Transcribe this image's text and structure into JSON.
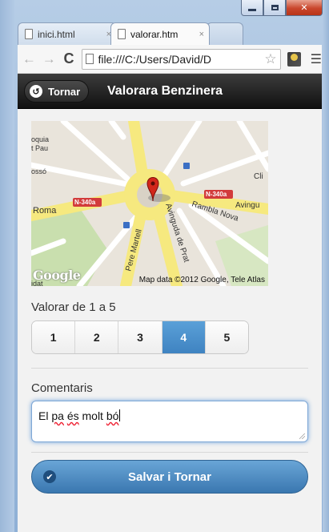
{
  "browser": {
    "tabs": [
      {
        "label": "inici.html",
        "active": false
      },
      {
        "label": "valorar.htm",
        "active": true
      }
    ],
    "url": "file:///C:/Users/David/D"
  },
  "header": {
    "back_label": "Tornar",
    "title": "Valorara Benzinera"
  },
  "map": {
    "street_labels": [
      "Rambla Nova",
      "Avinguda de Prat",
      "Pere Martell",
      "N-340a",
      "N-340a",
      "Roma",
      "Avingu",
      "oquia",
      "t Pau",
      "ossó",
      "Cli",
      "idat"
    ],
    "logo": "Google",
    "attribution": "Map data ©2012 Google, Tele Atlas"
  },
  "rating": {
    "label": "Valorar de 1 a 5",
    "options": [
      "1",
      "2",
      "3",
      "4",
      "5"
    ],
    "selected": "4"
  },
  "comments": {
    "label": "Comentaris",
    "value_parts": [
      "El ",
      "pa",
      " ",
      "és",
      " molt ",
      "bó"
    ]
  },
  "save_button": {
    "label": "Salvar i Tornar"
  },
  "colors": {
    "header_bg": "#1f1f1f",
    "selected_rating": "#4a8fcd",
    "save_button": "#4f8cc4",
    "road_yellow": "#f8ec8a",
    "road_label_red": "#d23b3b"
  }
}
